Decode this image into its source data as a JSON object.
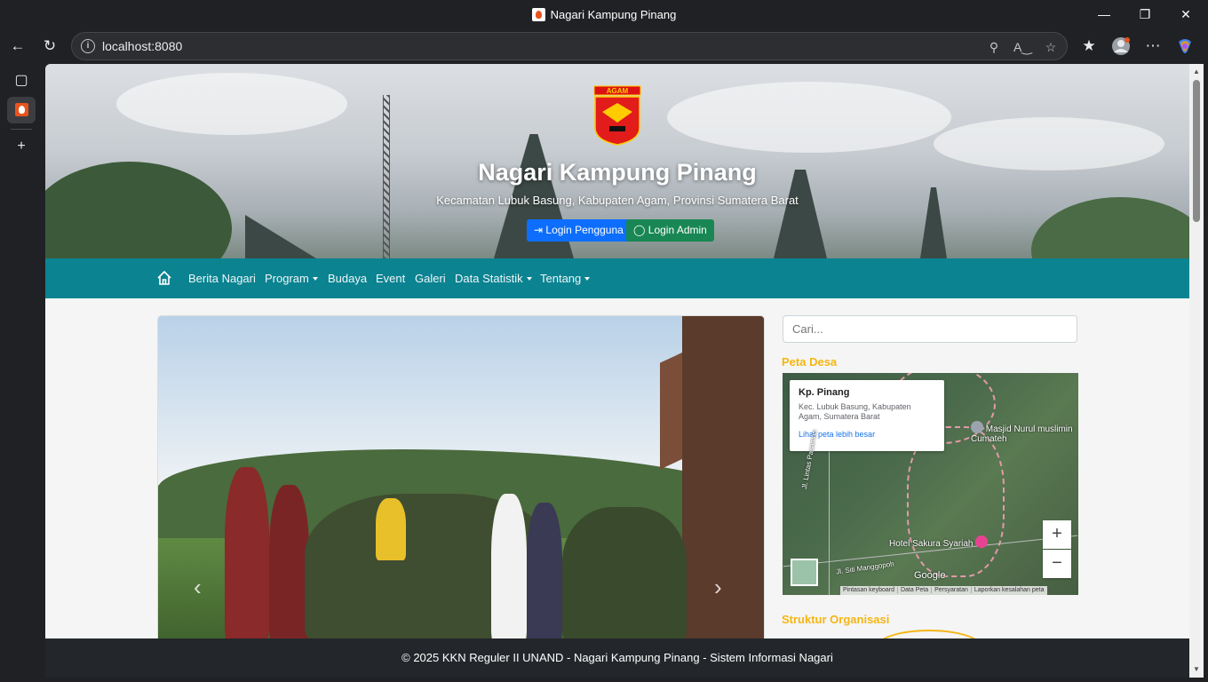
{
  "window": {
    "title": "Nagari Kampung Pinang"
  },
  "browser": {
    "url": "localhost:8080"
  },
  "hero": {
    "emblem_text": "AGAM",
    "title": "Nagari Kampung Pinang",
    "subtitle": "Kecamatan Lubuk Basung, Kabupaten Agam, Provinsi Sumatera Barat",
    "login_user": "Login Pengguna",
    "login_admin": "Login Admin"
  },
  "nav": {
    "items": [
      "Berita Nagari",
      "Program",
      "Budaya",
      "Event",
      "Galeri",
      "Data Statistik",
      "Tentang"
    ]
  },
  "sidebar": {
    "search_placeholder": "Cari...",
    "map_heading": "Peta Desa",
    "org_heading": "Struktur Organisasi"
  },
  "map": {
    "place_name": "Kp. Pinang",
    "place_address": "Kec. Lubuk Basung, Kabupaten Agam, Sumatera Barat",
    "larger_map_link": "Lihat peta lebih besar",
    "poi_1": "Masjid Nurul muslimin Cumateh",
    "poi_2": "Hotel Sakura Syariah",
    "road_1": "Jl. Lintas Pasaman",
    "road_2": "Jl. Siti Manggopoh",
    "google": "Google",
    "attrib_keyboard": "Pintasan keyboard",
    "attrib_data": "Data Peta",
    "attrib_terms": "Persyaratan",
    "attrib_report": "Laporkan kesalahan peta"
  },
  "footer": {
    "text": "© 2025 KKN Reguler II UNAND - Nagari Kampung Pinang - Sistem Informasi Nagari"
  },
  "colors": {
    "navbar": "#0b8391",
    "accent": "#f5b614",
    "footer": "#23272b"
  }
}
